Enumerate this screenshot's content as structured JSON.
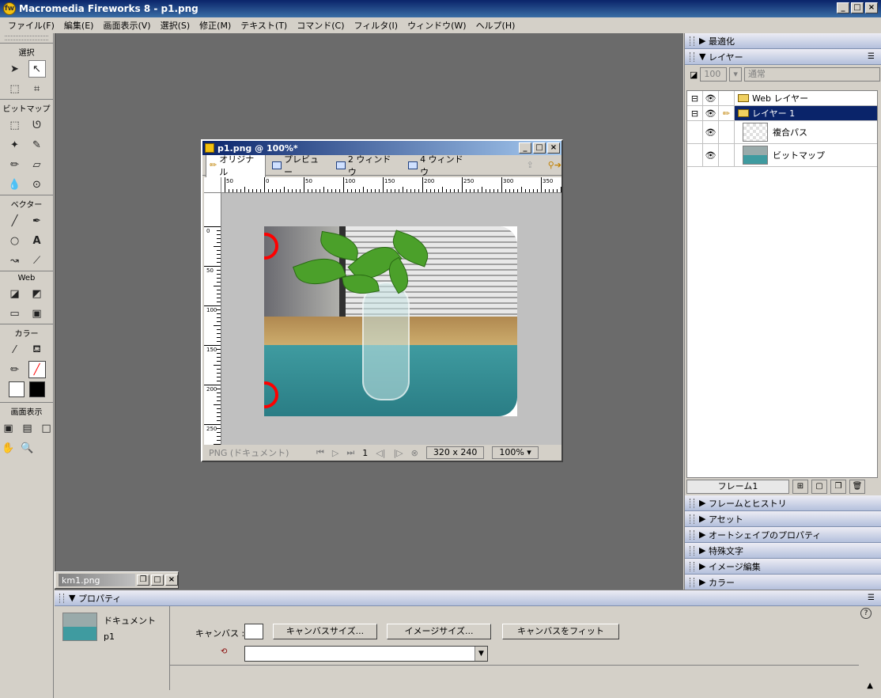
{
  "window": {
    "title": "Macromedia Fireworks 8 - p1.png",
    "min": "_",
    "max": "□",
    "close": "×"
  },
  "menu": [
    "ファイル(F)",
    "編集(E)",
    "画面表示(V)",
    "選択(S)",
    "修正(M)",
    "テキスト(T)",
    "コマンド(C)",
    "フィルタ(I)",
    "ウィンドウ(W)",
    "ヘルプ(H)"
  ],
  "tools": {
    "sections": [
      "選択",
      "ビットマップ",
      "ベクター",
      "Web",
      "カラー",
      "画面表示"
    ]
  },
  "document": {
    "title": "p1.png @ 100%*",
    "tabs": [
      "オリジナル",
      "プレビュー",
      "2 ウィンドウ",
      "4 ウィンドウ"
    ],
    "ruler_h": [
      "50",
      "0",
      "50",
      "100",
      "150",
      "200",
      "250",
      "300",
      "350"
    ],
    "ruler_v": [
      "0",
      "50",
      "100",
      "150",
      "200",
      "250"
    ],
    "status_type": "PNG (ドキュメント)",
    "frame_num": "1",
    "size": "320 x 240",
    "zoom": "100%"
  },
  "minidoc": {
    "title": "km1.png"
  },
  "panels": {
    "optimize": "最適化",
    "layers": "レイヤー",
    "opacity": "100",
    "blend": "通常",
    "layer_rows": [
      {
        "name": "Web レイヤー"
      },
      {
        "name": "レイヤー 1"
      },
      {
        "name": "複合パス"
      },
      {
        "name": "ビットマップ"
      }
    ],
    "frame": "フレーム1",
    "collapsed": [
      "フレームとヒストリ",
      "アセット",
      "オートシェイプのプロパティ",
      "特殊文字",
      "イメージ編集",
      "カラー"
    ]
  },
  "properties": {
    "title": "プロパティ",
    "doc_label": "ドキュメント",
    "doc_name": "p1",
    "canvas_label": "キャンバス :",
    "canvas_size": "キャンバスサイズ...",
    "image_size": "イメージサイズ...",
    "fit_canvas": "キャンバスをフィット",
    "help": "?"
  }
}
